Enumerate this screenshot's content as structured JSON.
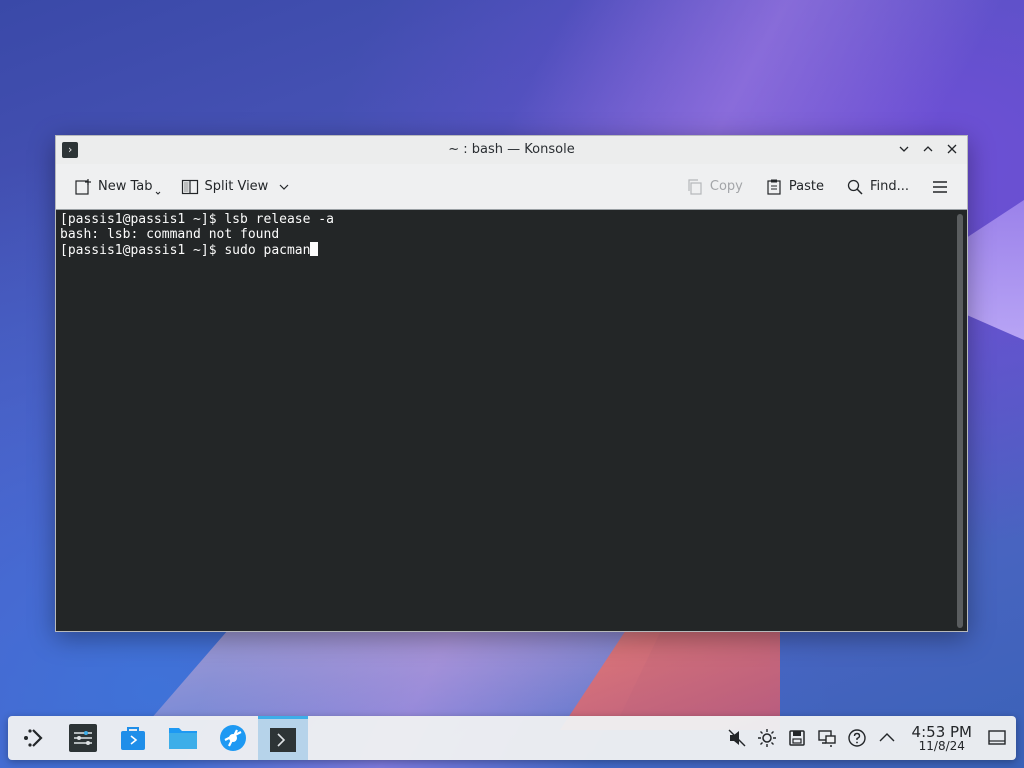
{
  "window": {
    "title": "~ : bash — Konsole"
  },
  "toolbar": {
    "new_tab": "New Tab",
    "split_view": "Split View",
    "copy": "Copy",
    "paste": "Paste",
    "find": "Find..."
  },
  "terminal": {
    "lines": [
      "[passis1@passis1 ~]$ lsb release -a",
      "bash: lsb: command not found",
      "[passis1@passis1 ~]$ sudo pacman"
    ]
  },
  "taskbar": {
    "apps": [
      "application-launcher",
      "system-settings",
      "discover",
      "dolphin",
      "web-browser",
      "konsole"
    ],
    "active_app": "konsole"
  },
  "tray": {
    "time": "4:53 PM",
    "date": "11/8/24"
  },
  "colors": {
    "terminal_bg": "#232627",
    "terminal_fg": "#fcfcfc",
    "accent": "#3daee9"
  }
}
